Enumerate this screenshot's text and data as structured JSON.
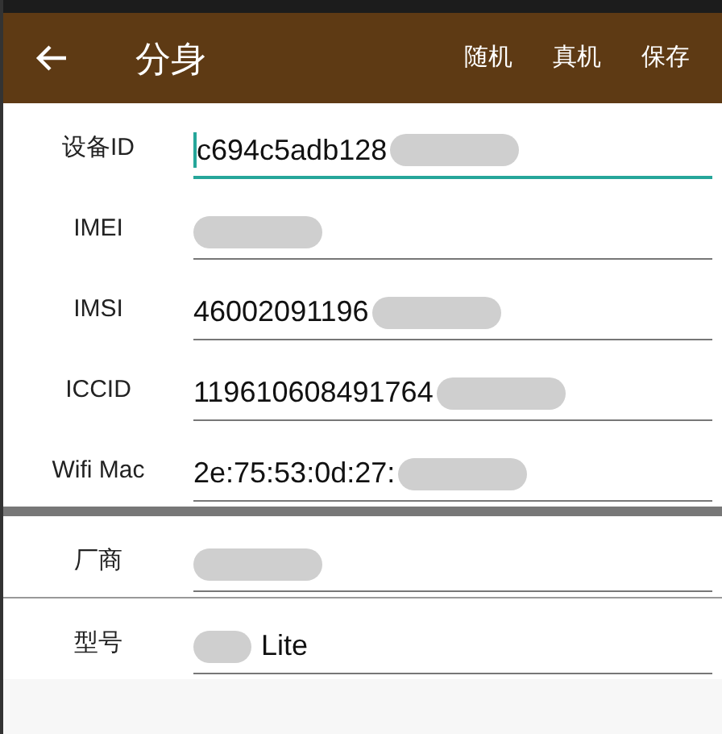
{
  "header": {
    "title": "分身",
    "actions": [
      "随机",
      "真机",
      "保存"
    ]
  },
  "sections": [
    {
      "fields": [
        {
          "label": "设备ID",
          "value": "c694c5adb128",
          "focused": true,
          "redacted": true,
          "blur_before_value": false
        },
        {
          "label": "IMEI",
          "focused": false,
          "redacted": true,
          "blur_before_value": false
        },
        {
          "label": "IMSI",
          "value": "46002091196",
          "focused": false,
          "redacted": true,
          "blur_before_value": false
        },
        {
          "label": "ICCID",
          "value": "119610608491764",
          "focused": false,
          "redacted": true,
          "blur_before_value": false
        },
        {
          "label": "Wifi Mac",
          "value": "2e:75:53:0d:27:",
          "focused": false,
          "redacted": true,
          "blur_before_value": false
        }
      ]
    },
    {
      "fields": [
        {
          "label": "厂商",
          "focused": false,
          "redacted": true,
          "blur_before_value": false
        }
      ]
    },
    {
      "fields": [
        {
          "label": "型号",
          "value": "Lite",
          "focused": false,
          "redacted": true,
          "blur_before_value": true
        }
      ]
    }
  ]
}
